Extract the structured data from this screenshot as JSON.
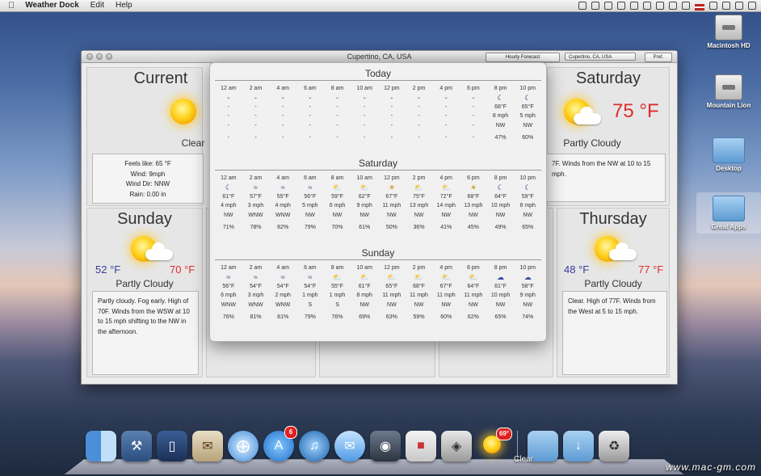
{
  "menubar": {
    "apple": "",
    "app_name": "Weather Dock",
    "menus": [
      "Edit",
      "Help"
    ]
  },
  "window": {
    "title": "Cupertino, CA, USA",
    "view_select": "Hourly Forecast",
    "location_select": "Cupertino, CA, USA",
    "pref_button": "Pref."
  },
  "current": {
    "title": "Current",
    "condition": "Clear",
    "details": [
      {
        "label": "Feels like:",
        "value": "65 °F"
      },
      {
        "label": "Wind:",
        "value": "9mph"
      },
      {
        "label": "Wind Dir:",
        "value": "NNW"
      },
      {
        "label": "Rain:",
        "value": "0.00 in"
      }
    ]
  },
  "saturday_panel": {
    "title": "Saturday",
    "temp": "75 °F",
    "condition": "Partly Cloudy",
    "description": "7F. Winds from the NW at 10 to 15 mph."
  },
  "sunday_panel": {
    "title": "Sunday",
    "lo": "52 °F",
    "hi": "70 °F",
    "condition": "Partly Cloudy",
    "description": "Partly cloudy. Fog early. High of 70F. Winds from the WSW at 10 to 15 mph shifting to the NW in the afternoon."
  },
  "thursday_panel": {
    "title": "Thursday",
    "lo": "48 °F",
    "hi": "77 °F",
    "condition": "Partly Cloudy",
    "description": "Clear. High of 77F. Winds from the West at 5 to 15 mph."
  },
  "hourly": {
    "today": {
      "title": "Today",
      "hours": [
        {
          "time": "12 am",
          "icon": "none",
          "temp": "-",
          "wind": "-",
          "dir": "-",
          "hum": "-"
        },
        {
          "time": "2 am",
          "icon": "none",
          "temp": "-",
          "wind": "-",
          "dir": "-",
          "hum": "-"
        },
        {
          "time": "4 am",
          "icon": "none",
          "temp": "-",
          "wind": "-",
          "dir": "-",
          "hum": "-"
        },
        {
          "time": "6 am",
          "icon": "none",
          "temp": "-",
          "wind": "-",
          "dir": "-",
          "hum": "-"
        },
        {
          "time": "8 am",
          "icon": "none",
          "temp": "-",
          "wind": "-",
          "dir": "-",
          "hum": "-"
        },
        {
          "time": "10 am",
          "icon": "none",
          "temp": "-",
          "wind": "-",
          "dir": "-",
          "hum": "-"
        },
        {
          "time": "12 pm",
          "icon": "none",
          "temp": "-",
          "wind": "-",
          "dir": "-",
          "hum": "-"
        },
        {
          "time": "2 pm",
          "icon": "none",
          "temp": "-",
          "wind": "-",
          "dir": "-",
          "hum": "-"
        },
        {
          "time": "4 pm",
          "icon": "none",
          "temp": "-",
          "wind": "-",
          "dir": "-",
          "hum": "-"
        },
        {
          "time": "6 pm",
          "icon": "none",
          "temp": "-",
          "wind": "-",
          "dir": "-",
          "hum": "-"
        },
        {
          "time": "8 pm",
          "icon": "moon",
          "temp": "68°F",
          "wind": "8 mph",
          "dir": "NW",
          "hum": "47%"
        },
        {
          "time": "10 pm",
          "icon": "moon",
          "temp": "65°F",
          "wind": "5 mph",
          "dir": "NW",
          "hum": "60%"
        }
      ]
    },
    "saturday": {
      "title": "Saturday",
      "hours": [
        {
          "time": "12 am",
          "icon": "moon",
          "temp": "61°F",
          "wind": "4 mph",
          "dir": "NW",
          "hum": "71%"
        },
        {
          "time": "2 am",
          "icon": "fog",
          "temp": "57°F",
          "wind": "3 mph",
          "dir": "WNW",
          "hum": "78%"
        },
        {
          "time": "4 am",
          "icon": "fog",
          "temp": "55°F",
          "wind": "4 mph",
          "dir": "WNW",
          "hum": "82%"
        },
        {
          "time": "6 am",
          "icon": "fog",
          "temp": "56°F",
          "wind": "5 mph",
          "dir": "NW",
          "hum": "79%"
        },
        {
          "time": "8 am",
          "icon": "pc",
          "temp": "59°F",
          "wind": "6 mph",
          "dir": "NW",
          "hum": "70%"
        },
        {
          "time": "10 am",
          "icon": "pc",
          "temp": "62°F",
          "wind": "9 mph",
          "dir": "NW",
          "hum": "61%"
        },
        {
          "time": "12 pm",
          "icon": "sunny",
          "temp": "67°F",
          "wind": "11 mph",
          "dir": "NW",
          "hum": "50%"
        },
        {
          "time": "2 pm",
          "icon": "pc",
          "temp": "75°F",
          "wind": "13 mph",
          "dir": "NW",
          "hum": "36%"
        },
        {
          "time": "4 pm",
          "icon": "pc",
          "temp": "72°F",
          "wind": "14 mph",
          "dir": "NW",
          "hum": "41%"
        },
        {
          "time": "6 pm",
          "icon": "sunny",
          "temp": "68°F",
          "wind": "13 mph",
          "dir": "NW",
          "hum": "45%"
        },
        {
          "time": "8 pm",
          "icon": "moon",
          "temp": "64°F",
          "wind": "10 mph",
          "dir": "NW",
          "hum": "49%"
        },
        {
          "time": "10 pm",
          "icon": "moon",
          "temp": "59°F",
          "wind": "8 mph",
          "dir": "NW",
          "hum": "65%"
        }
      ]
    },
    "sunday": {
      "title": "Sunday",
      "hours": [
        {
          "time": "12 am",
          "icon": "fog",
          "temp": "56°F",
          "wind": "6 mph",
          "dir": "WNW",
          "hum": "76%"
        },
        {
          "time": "2 am",
          "icon": "fog",
          "temp": "54°F",
          "wind": "3 mph",
          "dir": "WNW",
          "hum": "81%"
        },
        {
          "time": "4 am",
          "icon": "fog",
          "temp": "54°F",
          "wind": "2 mph",
          "dir": "WNW",
          "hum": "81%"
        },
        {
          "time": "6 am",
          "icon": "fog",
          "temp": "54°F",
          "wind": "1 mph",
          "dir": "S",
          "hum": "79%"
        },
        {
          "time": "8 am",
          "icon": "pc",
          "temp": "55°F",
          "wind": "1 mph",
          "dir": "S",
          "hum": "76%"
        },
        {
          "time": "10 am",
          "icon": "pc",
          "temp": "61°F",
          "wind": "8 mph",
          "dir": "NW",
          "hum": "69%"
        },
        {
          "time": "12 pm",
          "icon": "pc",
          "temp": "65°F",
          "wind": "11 mph",
          "dir": "NW",
          "hum": "63%"
        },
        {
          "time": "2 pm",
          "icon": "pc",
          "temp": "68°F",
          "wind": "11 mph",
          "dir": "NW",
          "hum": "59%"
        },
        {
          "time": "4 pm",
          "icon": "pc",
          "temp": "67°F",
          "wind": "11 mph",
          "dir": "NW",
          "hum": "60%"
        },
        {
          "time": "6 pm",
          "icon": "pc",
          "temp": "64°F",
          "wind": "11 mph",
          "dir": "NW",
          "hum": "62%"
        },
        {
          "time": "8 pm",
          "icon": "cloudy",
          "temp": "61°F",
          "wind": "10 mph",
          "dir": "NW",
          "hum": "65%"
        },
        {
          "time": "10 pm",
          "icon": "cloudy",
          "temp": "58°F",
          "wind": "9 mph",
          "dir": "NW",
          "hum": "74%"
        }
      ]
    }
  },
  "desktop_icons": [
    "Macintosh HD",
    "Mountain Lion",
    "Desktop",
    "Great Apps"
  ],
  "dock": {
    "app_store_badge": "6",
    "weather_badge": "69°",
    "weather_label": "Clear"
  },
  "watermark": "www.mac-gm.com",
  "colors": {
    "hi": "#e02b2b",
    "lo": "#3a3aa0"
  }
}
